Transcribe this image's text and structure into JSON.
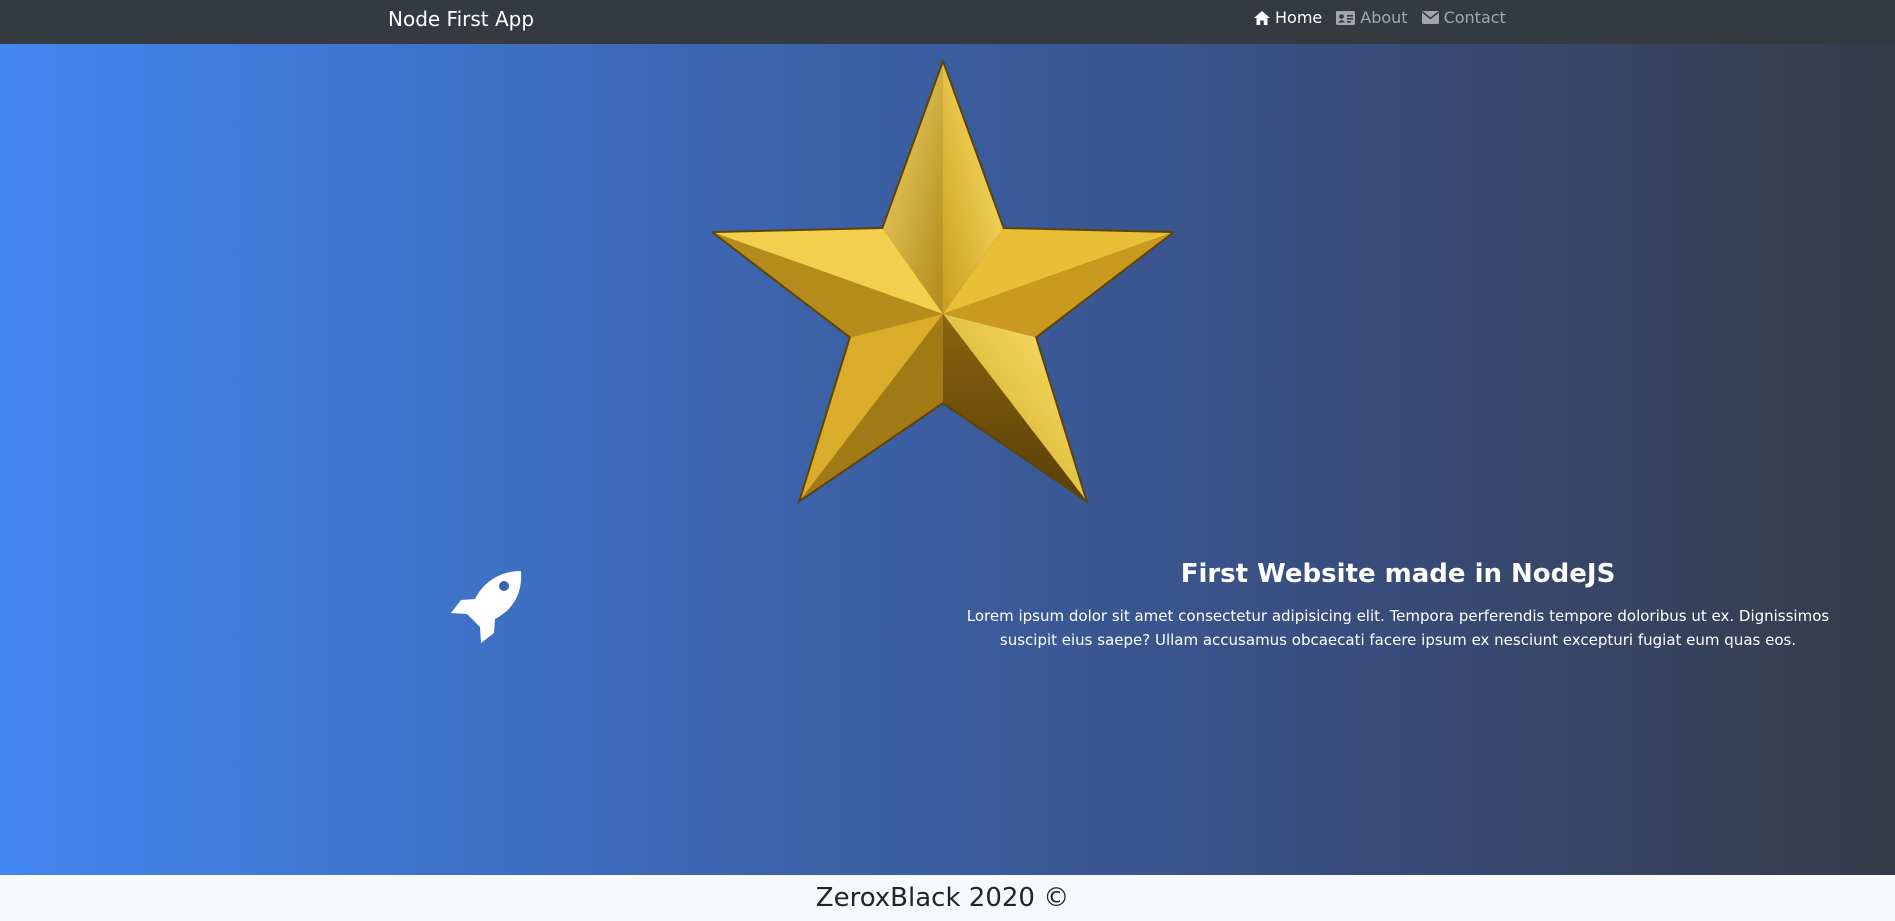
{
  "navbar": {
    "brand": "Node First App",
    "items": [
      {
        "label": "Home",
        "icon": "home-icon",
        "active": true
      },
      {
        "label": "About",
        "icon": "id-card-icon",
        "active": false
      },
      {
        "label": "Contact",
        "icon": "envelope-icon",
        "active": false
      }
    ]
  },
  "hero": {
    "title": "First Website made in NodeJS",
    "body": "Lorem ipsum dolor sit amet consectetur adipisicing elit. Tempora perferendis tempore doloribus ut ex. Dignissimos suscipit eius saepe? Ullam accusamus obcaecati facere ipsum ex nesciunt excepturi fugiat eum quas eos.",
    "image_icon": "gold-star-icon",
    "feature_icon": "rocket-icon"
  },
  "footer": {
    "text": "ZeroxBlack 2020 ©"
  },
  "colors": {
    "navbar": "#343a40",
    "gradient_start": "#4286f0",
    "gradient_end": "#353b48",
    "footer": "#f8f9fa"
  }
}
